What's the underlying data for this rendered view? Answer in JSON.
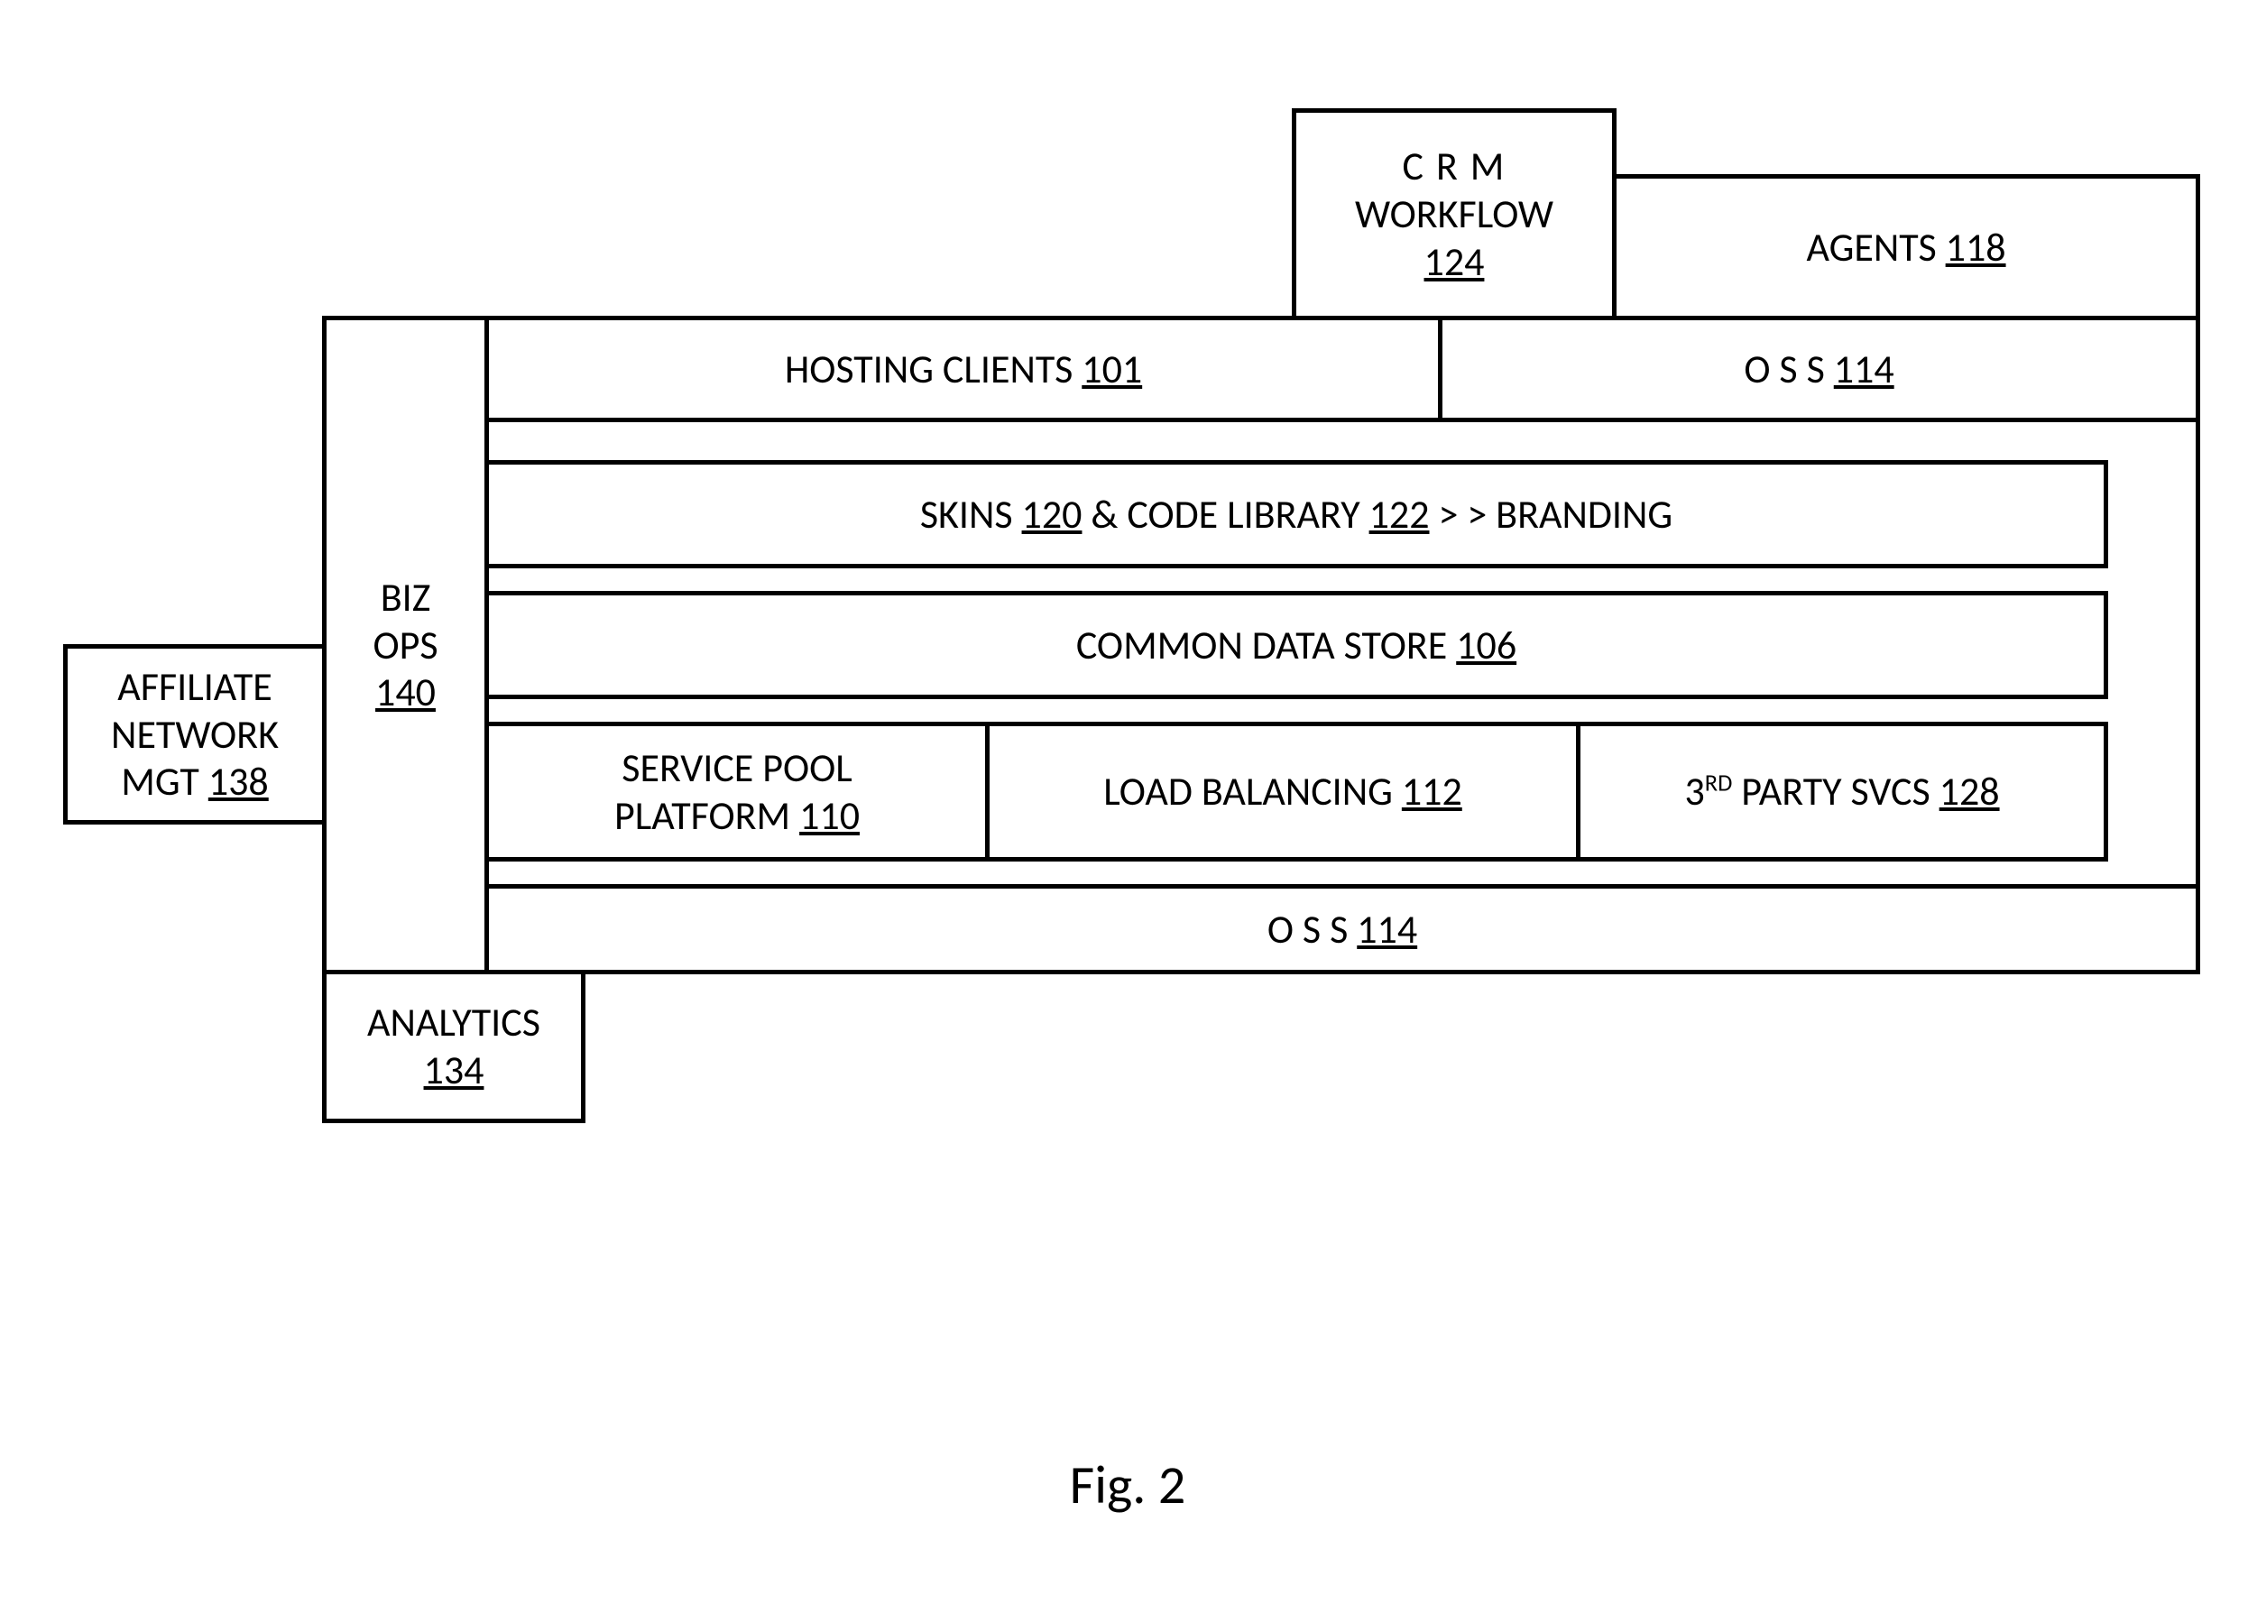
{
  "top": {
    "crm": {
      "l1": "C R M",
      "l2": "WORKFLOW",
      "ref": "124"
    },
    "agents": {
      "name": "AGENTS",
      "ref": "118"
    }
  },
  "left": {
    "affiliate": {
      "l1": "AFFILIATE",
      "l2": "NETWORK",
      "l3pre": "MGT",
      "ref": "138"
    },
    "bizops": {
      "l1": "BIZ",
      "l2": "OPS",
      "ref": "140"
    },
    "analytics": {
      "name": "ANALYTICS",
      "ref": "134"
    }
  },
  "row1": {
    "hosting": {
      "name": "HOSTING CLIENTS",
      "ref": "101"
    },
    "oss": {
      "name": "O S S",
      "ref": "114"
    }
  },
  "row2": {
    "pre": "SKINS",
    "ref1": "120",
    "mid1": "& CODE LIBRARY",
    "ref2": "122",
    "tail": " > > BRANDING"
  },
  "row3": {
    "name": "COMMON DATA STORE",
    "ref": "106"
  },
  "row4": {
    "svcpool": {
      "l1": "SERVICE POOL",
      "l2pre": "PLATFORM",
      "ref": "110"
    },
    "loadbal": {
      "name": "LOAD BALANCING",
      "ref": "112"
    },
    "thirdparty": {
      "pre": "3",
      "sup": "RD",
      "rest": "PARTY SVCS",
      "ref": "128"
    }
  },
  "row5": {
    "name": "O S S",
    "ref": "114"
  },
  "caption": "Fig. 2"
}
